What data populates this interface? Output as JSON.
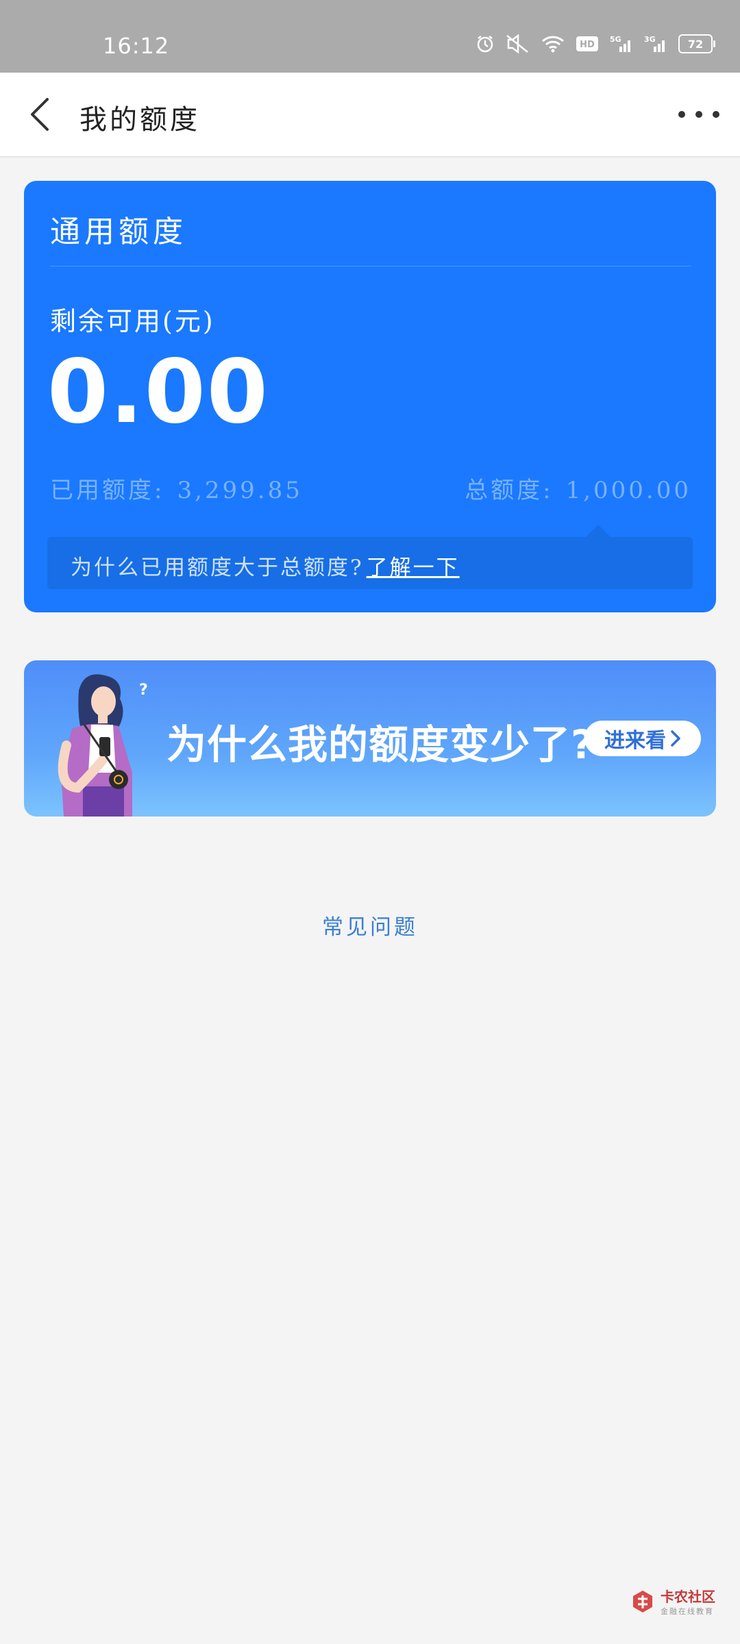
{
  "status_bar": {
    "time": "16:12",
    "battery": "72",
    "icons": [
      "alarm-icon",
      "mute-icon",
      "wifi-icon",
      "hd-icon",
      "signal-5g-icon",
      "signal-3g-icon"
    ]
  },
  "header": {
    "title": "我的额度",
    "back_icon": "back-arrow-icon",
    "more_icon": "more-icon"
  },
  "quota_card": {
    "title": "通用额度",
    "available_label": "剩余可用(元)",
    "available_amount": "0.00",
    "used_label": "已用额度:",
    "used_value": "3,299.85",
    "total_label": "总额度:",
    "total_value": "1,000.00",
    "notice_text": "为什么已用额度大于总额度?",
    "notice_link": "了解一下",
    "colors": {
      "card_bg": "#1a79ff",
      "notice_bg": "#176ee6"
    }
  },
  "banner": {
    "text": "为什么我的额度变少了?",
    "button_label": "进来看",
    "question_mark": "?"
  },
  "faq": {
    "label": "常见问题"
  },
  "watermark": {
    "title": "卡农社区",
    "subtitle": "金融在线教育"
  }
}
